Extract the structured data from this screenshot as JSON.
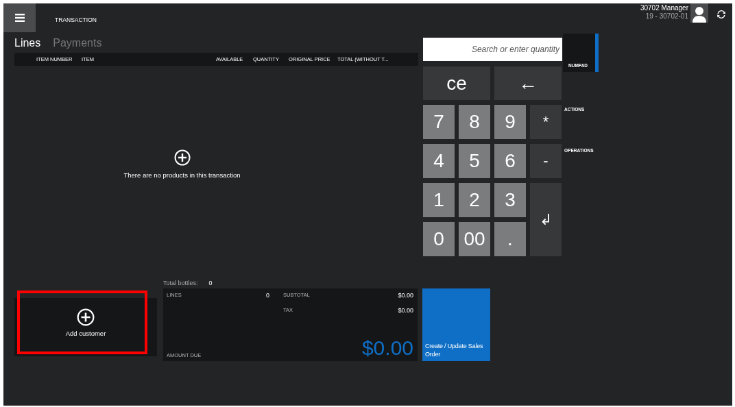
{
  "header": {
    "title": "TRANSACTION",
    "user_name": "30702 Manager",
    "register": "19 - 30702-01"
  },
  "tabs": [
    {
      "label": "Lines",
      "selected": true
    },
    {
      "label": "Payments",
      "selected": false
    }
  ],
  "table": {
    "columns": [
      "ITEM NUMBER",
      "ITEM",
      "AVAILABLE",
      "QUANTITY",
      "ORIGINAL PRICE",
      "TOTAL (WITHOUT T..."
    ],
    "empty_message": "There are no products in this transaction"
  },
  "search": {
    "placeholder": "Search or enter quantity"
  },
  "keys": [
    {
      "label": "ce",
      "kind": "wide"
    },
    {
      "label": "←",
      "kind": "wide"
    },
    {
      "label": "7",
      "kind": "digit"
    },
    {
      "label": "8",
      "kind": "digit"
    },
    {
      "label": "9",
      "kind": "digit"
    },
    {
      "label": "*",
      "kind": "op"
    },
    {
      "label": "4",
      "kind": "digit"
    },
    {
      "label": "5",
      "kind": "digit"
    },
    {
      "label": "6",
      "kind": "digit"
    },
    {
      "label": "-",
      "kind": "op"
    },
    {
      "label": "1",
      "kind": "digit"
    },
    {
      "label": "2",
      "kind": "digit"
    },
    {
      "label": "3",
      "kind": "digit"
    },
    {
      "label": "↲",
      "kind": "enter"
    },
    {
      "label": "0",
      "kind": "digit"
    },
    {
      "label": "00",
      "kind": "digit"
    },
    {
      "label": ".",
      "kind": "digit"
    }
  ],
  "side_tabs": [
    {
      "label": "NUMPAD",
      "selected": true
    },
    {
      "label": "ACTIONS",
      "selected": false
    },
    {
      "label": "OPERATIONS",
      "selected": false
    }
  ],
  "customer": {
    "label": "Add customer",
    "highlighted": true
  },
  "totals": {
    "bottles_label": "Total bottles:",
    "bottles": "0",
    "lines_label": "LINES",
    "lines": "0",
    "subtotal_label": "SUBTOTAL",
    "subtotal": "$0.00",
    "tax_label": "TAX",
    "tax": "$0.00",
    "amount_due_label": "AMOUNT DUE",
    "amount_due": "$0.00"
  },
  "action_button": {
    "label": "Create / Update Sales Order"
  }
}
